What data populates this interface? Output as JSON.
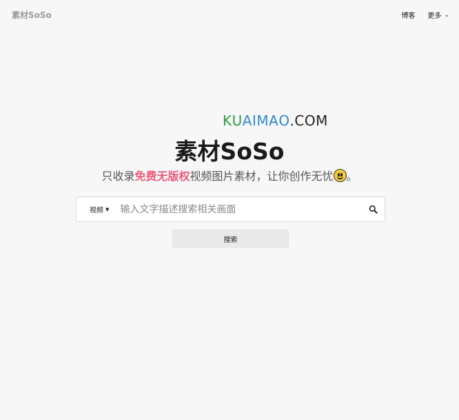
{
  "header": {
    "brand": "素材SoSo",
    "nav_blog": "博客",
    "nav_more": "更多"
  },
  "logo": {
    "art_text": "KUAIMAO.COM",
    "letters": [
      {
        "ch": "K",
        "color": "#2e9a3e"
      },
      {
        "ch": "U",
        "color": "#2e9a3e"
      },
      {
        "ch": "A",
        "color": "#2e8ad0"
      },
      {
        "ch": "I",
        "color": "#2e8ad0"
      },
      {
        "ch": "M",
        "color": "#2e8ad0"
      },
      {
        "ch": "A",
        "color": "#2e8ad0"
      },
      {
        "ch": "O",
        "color": "#2e8ad0"
      },
      {
        "ch": ".",
        "color": "#222222"
      },
      {
        "ch": "C",
        "color": "#222222"
      },
      {
        "ch": "O",
        "color": "#222222"
      },
      {
        "ch": "M",
        "color": "#222222"
      }
    ]
  },
  "hero": {
    "title": "素材SoSo",
    "tagline_pre": "只收录",
    "tagline_highlight": "免费无版权",
    "tagline_post": "视频图片素材，让你创作无忧",
    "tagline_end": "。",
    "highlight_color": "#ee5a7a"
  },
  "search": {
    "type_selected": "视频",
    "placeholder": "输入文字描述搜索相关画面",
    "value": "",
    "button_label": "搜索"
  }
}
